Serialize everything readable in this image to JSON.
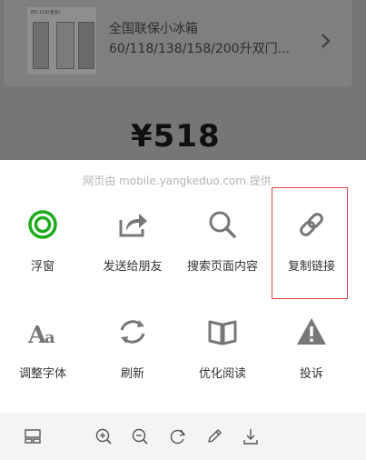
{
  "product": {
    "thumb_label": "BD-118(金色)",
    "title": "全国联保小冰箱",
    "subtitle": "60/118/138/158/200升双门...",
    "price": "¥518"
  },
  "share_sheet": {
    "provider_text": "网页由 mobile.yangkeduo.com 提供",
    "items": [
      {
        "label": "浮窗",
        "icon": "floating-window-icon"
      },
      {
        "label": "发送给朋友",
        "icon": "share-icon"
      },
      {
        "label": "搜索页面内容",
        "icon": "search-icon"
      },
      {
        "label": "复制链接",
        "icon": "link-icon"
      },
      {
        "label": "调整字体",
        "icon": "font-icon"
      },
      {
        "label": "刷新",
        "icon": "refresh-icon"
      },
      {
        "label": "优化阅读",
        "icon": "reader-icon"
      },
      {
        "label": "投诉",
        "icon": "warning-icon"
      }
    ]
  },
  "toolbar": {
    "icons": [
      "layout-icon",
      "zoom-in-icon",
      "zoom-out-icon",
      "rotate-icon",
      "edit-icon",
      "download-icon"
    ]
  },
  "colors": {
    "accent_green": "#1aad19",
    "icon_gray": "#777777",
    "highlight_red": "#dd4444"
  }
}
